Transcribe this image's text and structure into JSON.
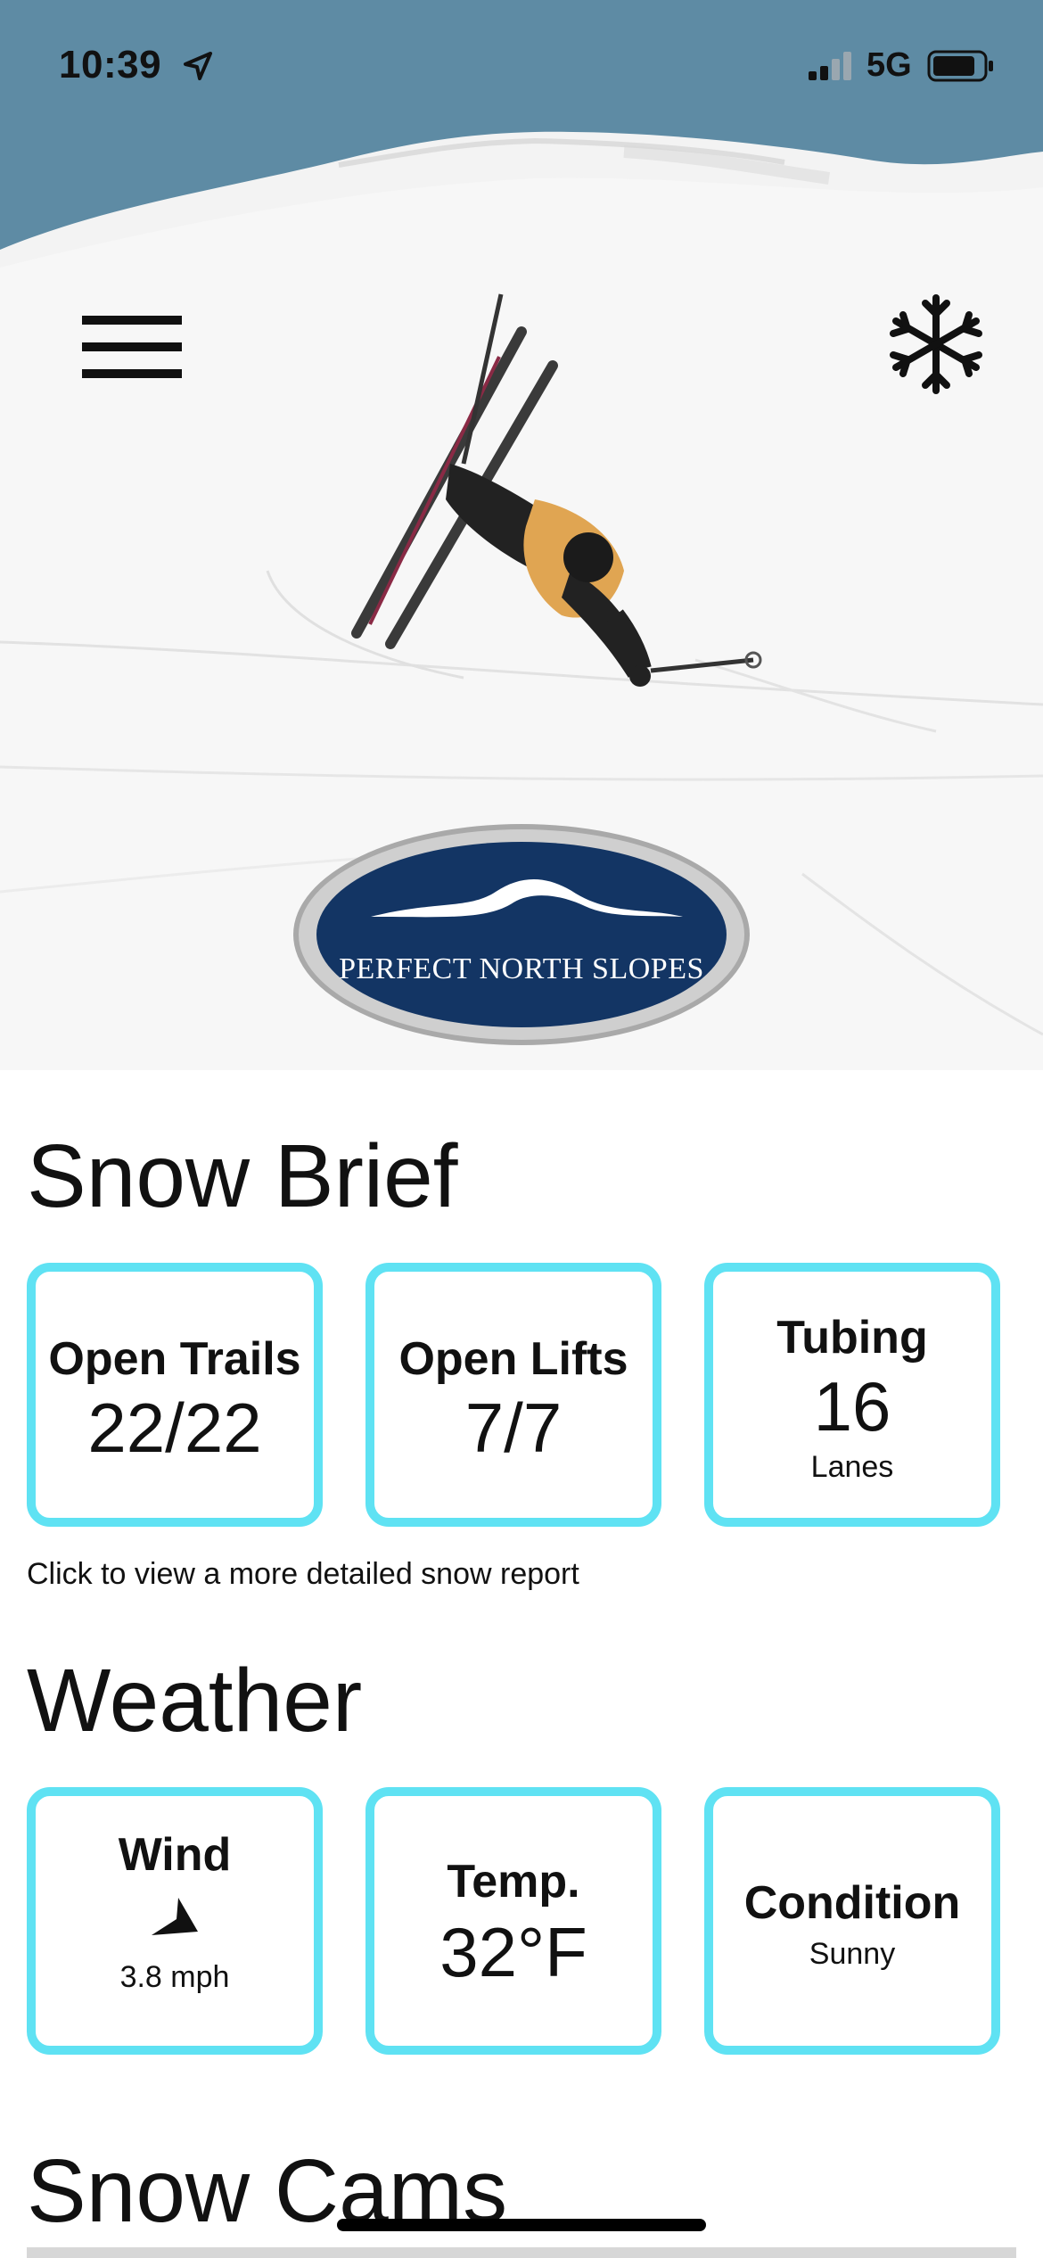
{
  "status_bar": {
    "time": "10:39",
    "network": "5G"
  },
  "brand": {
    "logo_text": "PERFECT NORTH SLOPES"
  },
  "colors": {
    "card_border": "#5fe2f3",
    "logo_navy": "#133564",
    "sky": "#5e8ba4"
  },
  "icons": {
    "menu": "hamburger-menu-icon",
    "snow": "snowflake-icon",
    "wind": "wind-direction-arrow-icon"
  },
  "snow_brief": {
    "title": "Snow Brief",
    "cards": [
      {
        "title": "Open Trails",
        "value": "22/22"
      },
      {
        "title": "Open Lifts",
        "value": "7/7"
      },
      {
        "title": "Tubing",
        "value": "16",
        "sub": "Lanes"
      }
    ],
    "note": "Click to view a more detailed snow report"
  },
  "weather": {
    "title": "Weather",
    "wind": {
      "title": "Wind",
      "speed": "3.8 mph"
    },
    "temp": {
      "title": "Temp.",
      "value": "32°F"
    },
    "condition": {
      "title": "Condition",
      "value": "Sunny"
    }
  },
  "snow_cams": {
    "title": "Snow Cams"
  }
}
